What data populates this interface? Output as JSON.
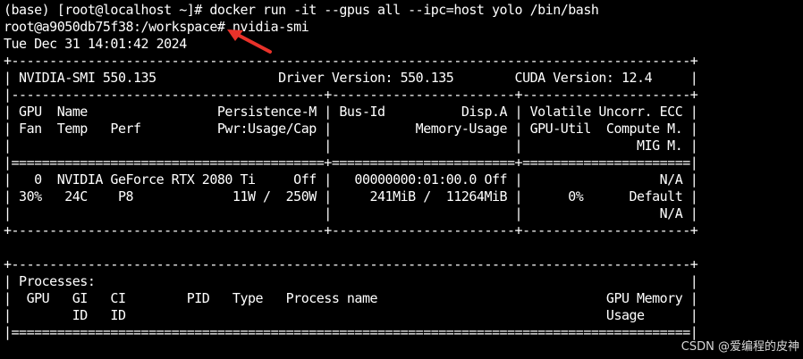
{
  "terminal": {
    "lines": [
      "(base) [root@localhost ~]# docker run -it --gpus all --ipc=host yolo /bin/bash",
      "root@a9050db75f38:/workspace# nvidia-smi",
      "Tue Dec 31 14:01:42 2024",
      "+-----------------------------------------------------------------------------------------+",
      "| NVIDIA-SMI 550.135                Driver Version: 550.135        CUDA Version: 12.4     |",
      "|-----------------------------------------+------------------------+----------------------+",
      "| GPU  Name                 Persistence-M | Bus-Id          Disp.A | Volatile Uncorr. ECC |",
      "| Fan  Temp   Perf          Pwr:Usage/Cap |           Memory-Usage | GPU-Util  Compute M. |",
      "|                                         |                        |               MIG M. |",
      "|=========================================+========================+======================|",
      "|   0  NVIDIA GeForce RTX 2080 Ti     Off |   00000000:01:00.0 Off |                  N/A |",
      "| 30%   24C    P8             11W /  250W |     241MiB /  11264MiB |      0%      Default |",
      "|                                         |                        |                  N/A |",
      "+-----------------------------------------+------------------------+----------------------+",
      "",
      "+-----------------------------------------------------------------------------------------+",
      "| Processes:                                                                              |",
      "|  GPU   GI   CI        PID   Type   Process name                              GPU Memory |",
      "|        ID   ID                                                               Usage      |",
      "|=========================================================================================|"
    ]
  },
  "watermark": "CSDN @爱编程的皮神",
  "colors": {
    "background": "#000000",
    "text": "#ffffff",
    "arrow": "#e8322a"
  },
  "icons": {
    "annotation": "red-arrow-icon"
  }
}
